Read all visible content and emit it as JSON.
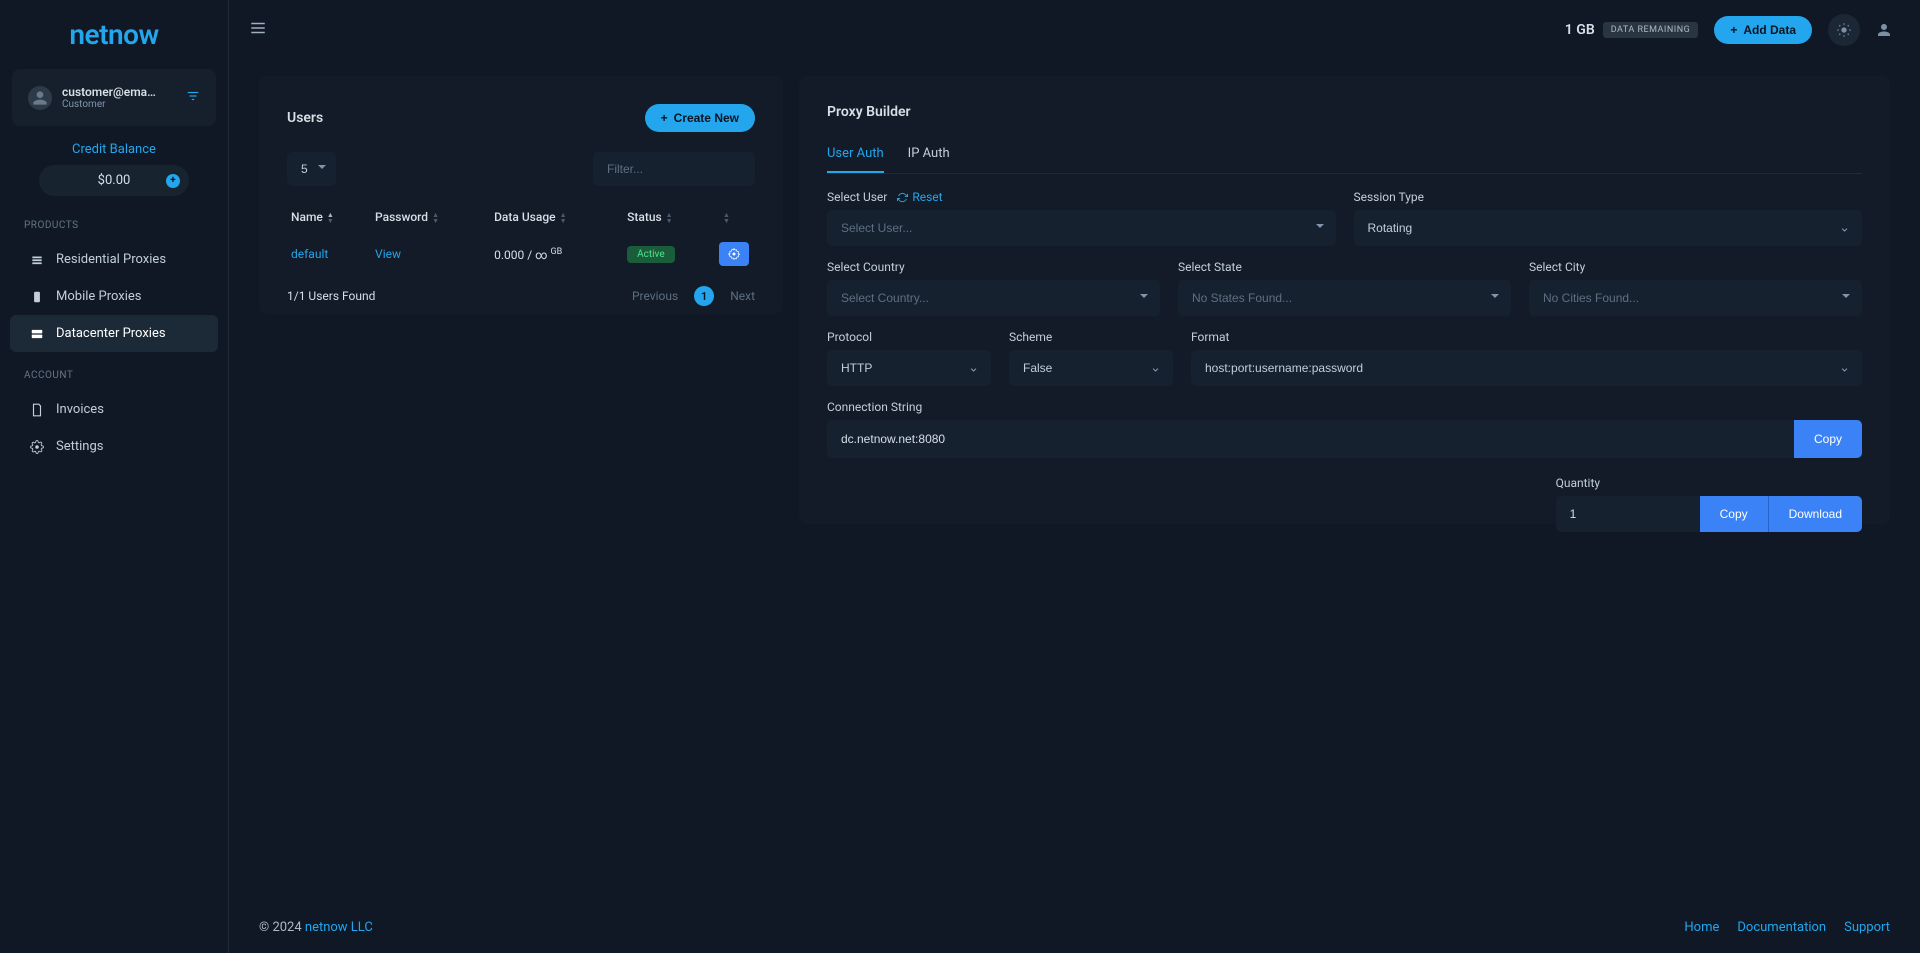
{
  "brand": "netnow",
  "user": {
    "email": "customer@ema…",
    "role": "Customer"
  },
  "credit": {
    "label": "Credit Balance",
    "value": "$0.00"
  },
  "nav": {
    "products_label": "PRODUCTS",
    "account_label": "ACCOUNT",
    "residential": "Residential Proxies",
    "mobile": "Mobile Proxies",
    "datacenter": "Datacenter Proxies",
    "invoices": "Invoices",
    "settings": "Settings"
  },
  "topbar": {
    "data_value": "1 GB",
    "data_label": "DATA REMAINING",
    "add_data": "Add Data"
  },
  "users": {
    "title": "Users",
    "create_new": "Create New",
    "page_size": "5",
    "filter_placeholder": "Filter...",
    "columns": {
      "name": "Name",
      "password": "Password",
      "data_usage": "Data Usage",
      "status": "Status"
    },
    "rows": [
      {
        "name": "default",
        "password": "View",
        "usage": "0.000 / ∞",
        "usage_unit": "GB",
        "status": "Active"
      }
    ],
    "found": "1/1 Users Found",
    "previous": "Previous",
    "page": "1",
    "next": "Next"
  },
  "builder": {
    "title": "Proxy Builder",
    "tab_user_auth": "User Auth",
    "tab_ip_auth": "IP Auth",
    "select_user_label": "Select User",
    "reset": "Reset",
    "select_user_placeholder": "Select User...",
    "session_type_label": "Session Type",
    "session_type_value": "Rotating",
    "select_country_label": "Select Country",
    "select_country_placeholder": "Select Country...",
    "select_state_label": "Select State",
    "select_state_placeholder": "No States Found...",
    "select_city_label": "Select City",
    "select_city_placeholder": "No Cities Found...",
    "protocol_label": "Protocol",
    "protocol_value": "HTTP",
    "scheme_label": "Scheme",
    "scheme_value": "False",
    "format_label": "Format",
    "format_value": "host:port:username:password",
    "connection_label": "Connection String",
    "connection_value": "dc.netnow.net:8080",
    "copy": "Copy",
    "quantity_label": "Quantity",
    "quantity_value": "1",
    "download": "Download"
  },
  "footer": {
    "copyright": "© 2024 ",
    "company": "netnow LLC",
    "home": "Home",
    "documentation": "Documentation",
    "support": "Support"
  }
}
